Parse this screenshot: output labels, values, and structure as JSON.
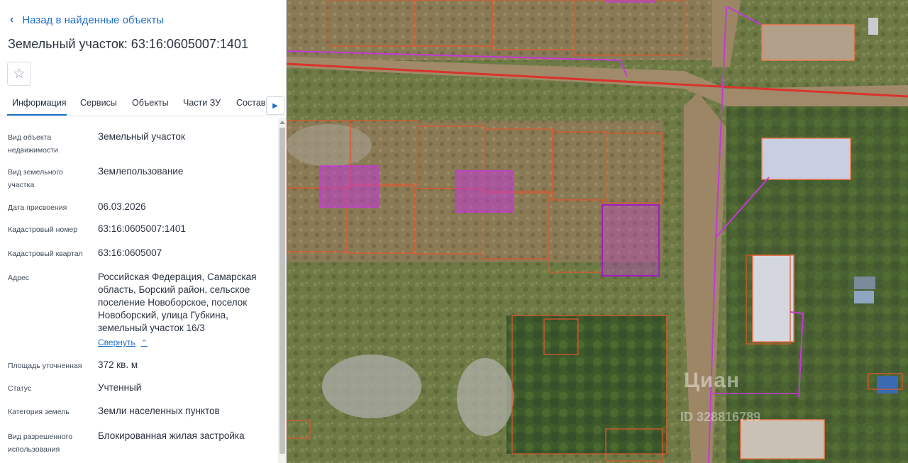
{
  "header": {
    "back_label": "Назад в найденные объекты",
    "title": "Земельный участок: 63:16:0605007:1401"
  },
  "tabs": [
    {
      "label": "Информация",
      "active": true
    },
    {
      "label": "Сервисы",
      "active": false
    },
    {
      "label": "Объекты",
      "active": false
    },
    {
      "label": "Части ЗУ",
      "active": false
    },
    {
      "label": "Состав",
      "active": false
    }
  ],
  "info": [
    {
      "label": "Вид объекта недвижимости",
      "value": "Земельный участок"
    },
    {
      "label": "Вид земельного участка",
      "value": "Землепользование"
    },
    {
      "label": "Дата присвоения",
      "value": "06.03.2026"
    },
    {
      "label": "Кадастровый номер",
      "value": "63:16:0605007:1401"
    },
    {
      "label": "Кадастровый квартал",
      "value": "63:16:0605007"
    },
    {
      "label": "Адрес",
      "value": "Российская Федерация, Самарская область, Борский район, сельское поселение Новоборское, поселок Новоборский, улица Губкина, земельный участок 16/3"
    },
    {
      "label": "Площадь уточненная",
      "value": "372 кв. м"
    },
    {
      "label": "Статус",
      "value": "Учтенный"
    },
    {
      "label": "Категория земель",
      "value": "Земли населенных пунктов"
    },
    {
      "label": "Вид разрешенного использования",
      "value": "Блокированная жилая застройка"
    }
  ],
  "collapse_label": "Свернуть",
  "icons": {
    "back": "chevron-left-icon",
    "favorite": "star-outline-icon",
    "tabs_next": "triangle-right-icon",
    "collapse": "chevron-up-icon"
  },
  "colors": {
    "accent": "#1f6fc5",
    "parcel_border": "#e0572e",
    "highlight": "#c23bd6",
    "road_line": "#d9342b"
  },
  "watermark": {
    "brand": "Циан",
    "id": "ID 328816789"
  }
}
